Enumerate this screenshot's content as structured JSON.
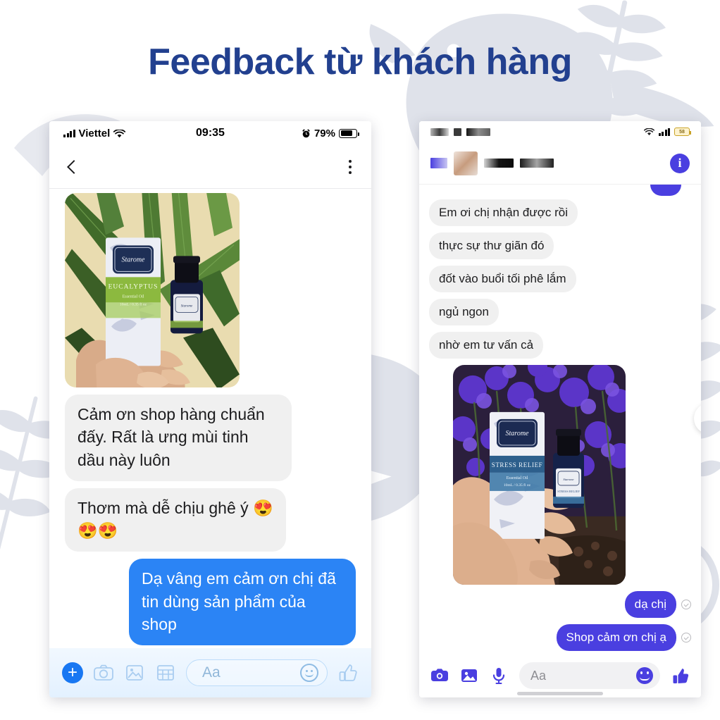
{
  "page": {
    "title": "Feedback từ khách hàng",
    "title_color": "#22408f",
    "background_color": "#ffffff",
    "pattern_color": "#dcdfe8",
    "pattern_motifs": [
      "bird",
      "fern-leaf"
    ]
  },
  "left_phone": {
    "platform": "ios",
    "status_bar": {
      "carrier": "Viettel",
      "wifi_icon": "wifi-icon",
      "signal_icon": "signal-bars-icon",
      "time": "09:35",
      "alarm_icon": "alarm-clock-icon",
      "battery_percent": "79%",
      "battery_level": 79
    },
    "nav_bar": {
      "back_icon": "chevron-left-icon",
      "menu_icon": "kebab-menu-icon"
    },
    "thread": {
      "photo": {
        "alt": "hand holding eucalyptus essential oil box with palm leaves",
        "product_brand": "Starome",
        "product_name": "EUCALYPTUS",
        "product_sub": "Essential Oil",
        "product_size": "10mL / 0.35 fl oz"
      },
      "messages": [
        {
          "dir": "in",
          "text": "Cảm ơn shop hàng chuẩn đấy. Rất là ưng mùi tinh dầu này luôn"
        },
        {
          "dir": "in",
          "text": "Thơm mà dễ chịu ghê ý 😍",
          "extra": "😍😍"
        },
        {
          "dir": "out",
          "text": "Dạ vâng em cảm ơn chị đã tin dùng sản phẩm của shop"
        }
      ]
    },
    "composer": {
      "plus_label": "+",
      "camera_icon": "camera-icon",
      "gallery_icon": "gallery-icon",
      "sticker_icon": "sticker-grid-icon",
      "input_placeholder": "Aa",
      "emoji_icon": "smiley-icon",
      "like_icon": "thumbs-up-icon"
    },
    "colors": {
      "incoming_bubble": "#f0f0f0",
      "outgoing_bubble": "#2b84f5",
      "accent": "#1877f2"
    }
  },
  "right_phone": {
    "platform": "android",
    "status_bar": {
      "left_censored": true,
      "wifi_icon": "wifi-icon",
      "signal_icon": "signal-bars-icon",
      "battery_label": "58"
    },
    "header": {
      "avatar_censored": true,
      "name_censored": true,
      "info_icon": "info-circle-icon"
    },
    "thread": {
      "messages": [
        {
          "dir": "in",
          "text": "Em ơi chị nhận được rồi"
        },
        {
          "dir": "in",
          "text": "thực sự thư giãn đó"
        },
        {
          "dir": "in",
          "text": "đốt vào buổi tối phê lắm"
        },
        {
          "dir": "in",
          "text": "ngủ ngon"
        },
        {
          "dir": "in",
          "text": "nhờ em tư vấn cả"
        }
      ],
      "photo": {
        "alt": "hand holding stress relief essential oil box with purple statice flowers",
        "product_brand": "Starome",
        "product_name": "STRESS RELIEF",
        "product_sub": "Essential Oil",
        "product_size": "10mL / 0.35 fl oz"
      },
      "outgoing": [
        {
          "text": "dạ chị",
          "status_icon": "delivered-check-icon"
        },
        {
          "text": "Shop cảm ơn chị ạ",
          "status_icon": "delivered-check-icon"
        }
      ]
    },
    "edit_fab": {
      "icon": "pencil-edit-icon"
    },
    "composer": {
      "camera_icon": "camera-icon",
      "gallery_icon": "gallery-icon",
      "mic_icon": "microphone-icon",
      "input_placeholder": "Aa",
      "emoji_icon": "smiley-icon",
      "like_icon": "thumbs-up-icon"
    },
    "colors": {
      "incoming_bubble": "#f0f0f0",
      "outgoing_bubble": "#4a3fe0",
      "accent": "#4a3fe0"
    }
  }
}
